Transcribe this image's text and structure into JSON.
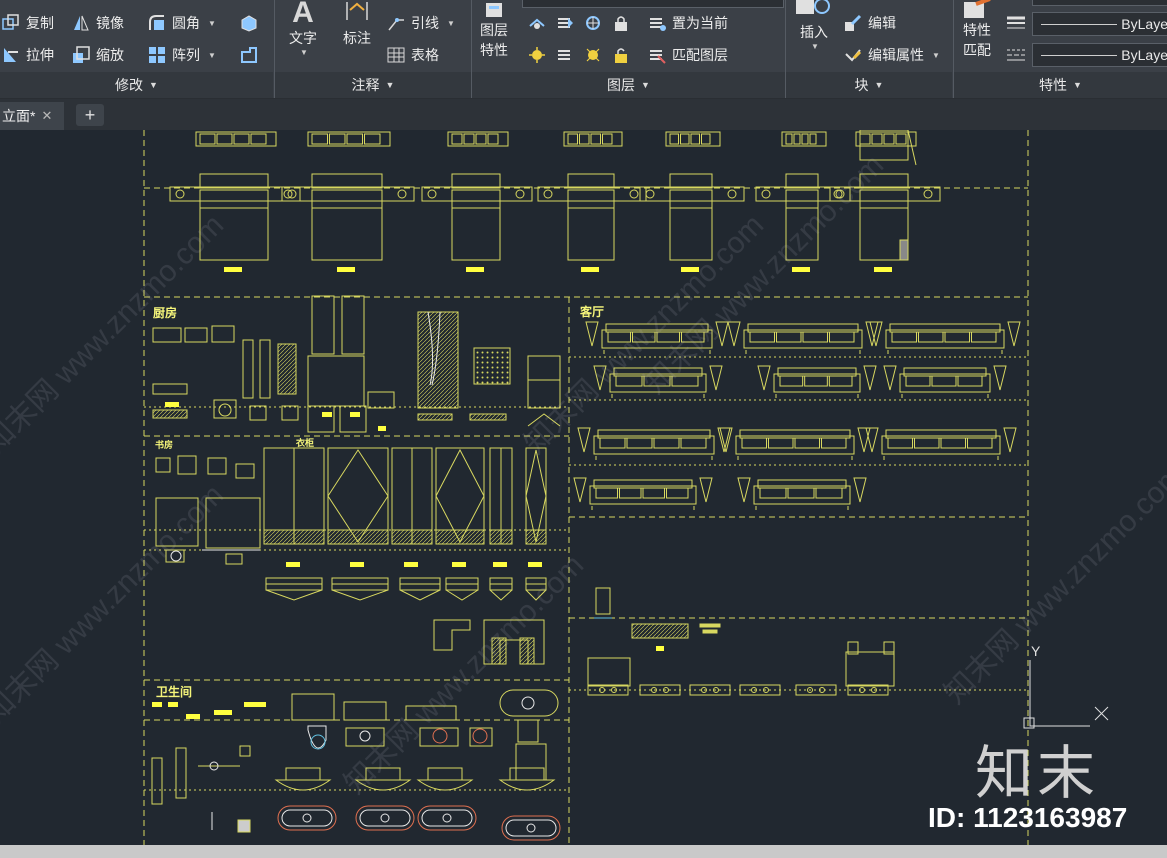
{
  "ribbon": {
    "modify": {
      "tools": [
        {
          "label": "复制",
          "icon": "copy-icon"
        },
        {
          "label": "镜像",
          "icon": "mirror-icon"
        },
        {
          "label": "圆角",
          "icon": "fillet-icon"
        },
        {
          "label": "拉伸",
          "icon": "stretch-icon"
        },
        {
          "label": "缩放",
          "icon": "scale-icon"
        },
        {
          "label": "阵列",
          "icon": "array-icon"
        }
      ],
      "title": "修改"
    },
    "annotate": {
      "text": "文字",
      "dimension": "标注",
      "leader": "引线",
      "table": "表格",
      "title": "注释"
    },
    "layers": {
      "properties_line1": "图层",
      "properties_line2": "特性",
      "make_current": "置为当前",
      "match_layer": "匹配图层",
      "title": "图层"
    },
    "block": {
      "insert": "插入",
      "edit": "编辑",
      "edit_attributes": "编辑属性",
      "title": "块"
    },
    "properties": {
      "match_line1": "特性",
      "match_line2": "匹配",
      "bylayer_1": "ByLaye",
      "bylayer_2": "ByLaye",
      "title": "特性"
    }
  },
  "tabs": {
    "active": "立面*"
  },
  "drawing": {
    "labels": {
      "kitchen": "厨房",
      "living": "客厅",
      "study": "书房",
      "wardrobe": "衣柜",
      "bathroom": "卫生间"
    }
  },
  "ucs": {
    "y_label": "Y"
  },
  "watermark": {
    "text": "知末网 www.znzmo.com",
    "logo": "知末",
    "id": "ID: 1123163987"
  }
}
